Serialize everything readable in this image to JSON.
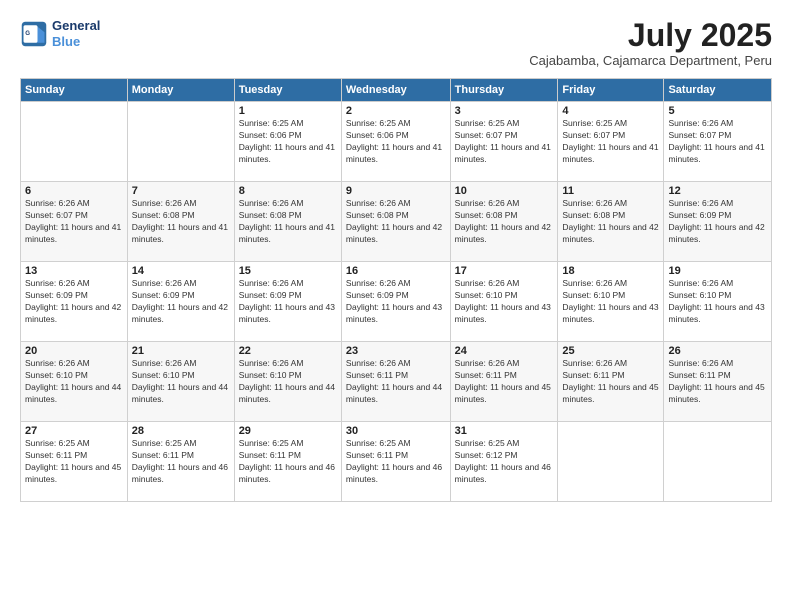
{
  "logo": {
    "line1": "General",
    "line2": "Blue"
  },
  "title": "July 2025",
  "subtitle": "Cajabamba, Cajamarca Department, Peru",
  "weekdays": [
    "Sunday",
    "Monday",
    "Tuesday",
    "Wednesday",
    "Thursday",
    "Friday",
    "Saturday"
  ],
  "weeks": [
    [
      {
        "day": "",
        "detail": ""
      },
      {
        "day": "",
        "detail": ""
      },
      {
        "day": "1",
        "detail": "Sunrise: 6:25 AM\nSunset: 6:06 PM\nDaylight: 11 hours and 41 minutes."
      },
      {
        "day": "2",
        "detail": "Sunrise: 6:25 AM\nSunset: 6:06 PM\nDaylight: 11 hours and 41 minutes."
      },
      {
        "day": "3",
        "detail": "Sunrise: 6:25 AM\nSunset: 6:07 PM\nDaylight: 11 hours and 41 minutes."
      },
      {
        "day": "4",
        "detail": "Sunrise: 6:25 AM\nSunset: 6:07 PM\nDaylight: 11 hours and 41 minutes."
      },
      {
        "day": "5",
        "detail": "Sunrise: 6:26 AM\nSunset: 6:07 PM\nDaylight: 11 hours and 41 minutes."
      }
    ],
    [
      {
        "day": "6",
        "detail": "Sunrise: 6:26 AM\nSunset: 6:07 PM\nDaylight: 11 hours and 41 minutes."
      },
      {
        "day": "7",
        "detail": "Sunrise: 6:26 AM\nSunset: 6:08 PM\nDaylight: 11 hours and 41 minutes."
      },
      {
        "day": "8",
        "detail": "Sunrise: 6:26 AM\nSunset: 6:08 PM\nDaylight: 11 hours and 41 minutes."
      },
      {
        "day": "9",
        "detail": "Sunrise: 6:26 AM\nSunset: 6:08 PM\nDaylight: 11 hours and 42 minutes."
      },
      {
        "day": "10",
        "detail": "Sunrise: 6:26 AM\nSunset: 6:08 PM\nDaylight: 11 hours and 42 minutes."
      },
      {
        "day": "11",
        "detail": "Sunrise: 6:26 AM\nSunset: 6:08 PM\nDaylight: 11 hours and 42 minutes."
      },
      {
        "day": "12",
        "detail": "Sunrise: 6:26 AM\nSunset: 6:09 PM\nDaylight: 11 hours and 42 minutes."
      }
    ],
    [
      {
        "day": "13",
        "detail": "Sunrise: 6:26 AM\nSunset: 6:09 PM\nDaylight: 11 hours and 42 minutes."
      },
      {
        "day": "14",
        "detail": "Sunrise: 6:26 AM\nSunset: 6:09 PM\nDaylight: 11 hours and 42 minutes."
      },
      {
        "day": "15",
        "detail": "Sunrise: 6:26 AM\nSunset: 6:09 PM\nDaylight: 11 hours and 43 minutes."
      },
      {
        "day": "16",
        "detail": "Sunrise: 6:26 AM\nSunset: 6:09 PM\nDaylight: 11 hours and 43 minutes."
      },
      {
        "day": "17",
        "detail": "Sunrise: 6:26 AM\nSunset: 6:10 PM\nDaylight: 11 hours and 43 minutes."
      },
      {
        "day": "18",
        "detail": "Sunrise: 6:26 AM\nSunset: 6:10 PM\nDaylight: 11 hours and 43 minutes."
      },
      {
        "day": "19",
        "detail": "Sunrise: 6:26 AM\nSunset: 6:10 PM\nDaylight: 11 hours and 43 minutes."
      }
    ],
    [
      {
        "day": "20",
        "detail": "Sunrise: 6:26 AM\nSunset: 6:10 PM\nDaylight: 11 hours and 44 minutes."
      },
      {
        "day": "21",
        "detail": "Sunrise: 6:26 AM\nSunset: 6:10 PM\nDaylight: 11 hours and 44 minutes."
      },
      {
        "day": "22",
        "detail": "Sunrise: 6:26 AM\nSunset: 6:10 PM\nDaylight: 11 hours and 44 minutes."
      },
      {
        "day": "23",
        "detail": "Sunrise: 6:26 AM\nSunset: 6:11 PM\nDaylight: 11 hours and 44 minutes."
      },
      {
        "day": "24",
        "detail": "Sunrise: 6:26 AM\nSunset: 6:11 PM\nDaylight: 11 hours and 45 minutes."
      },
      {
        "day": "25",
        "detail": "Sunrise: 6:26 AM\nSunset: 6:11 PM\nDaylight: 11 hours and 45 minutes."
      },
      {
        "day": "26",
        "detail": "Sunrise: 6:26 AM\nSunset: 6:11 PM\nDaylight: 11 hours and 45 minutes."
      }
    ],
    [
      {
        "day": "27",
        "detail": "Sunrise: 6:25 AM\nSunset: 6:11 PM\nDaylight: 11 hours and 45 minutes."
      },
      {
        "day": "28",
        "detail": "Sunrise: 6:25 AM\nSunset: 6:11 PM\nDaylight: 11 hours and 46 minutes."
      },
      {
        "day": "29",
        "detail": "Sunrise: 6:25 AM\nSunset: 6:11 PM\nDaylight: 11 hours and 46 minutes."
      },
      {
        "day": "30",
        "detail": "Sunrise: 6:25 AM\nSunset: 6:11 PM\nDaylight: 11 hours and 46 minutes."
      },
      {
        "day": "31",
        "detail": "Sunrise: 6:25 AM\nSunset: 6:12 PM\nDaylight: 11 hours and 46 minutes."
      },
      {
        "day": "",
        "detail": ""
      },
      {
        "day": "",
        "detail": ""
      }
    ]
  ]
}
